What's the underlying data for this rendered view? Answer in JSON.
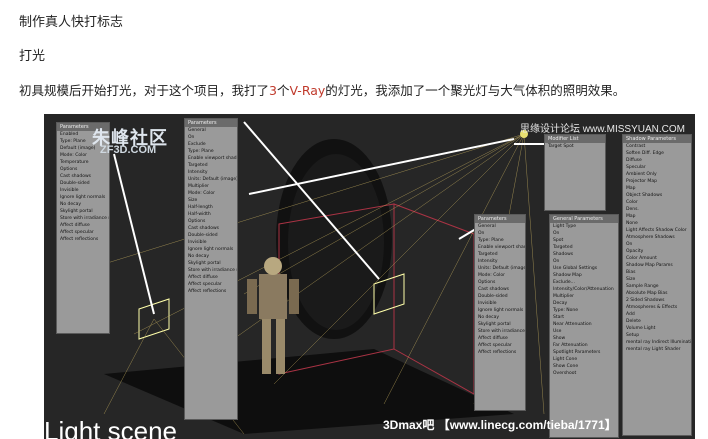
{
  "article": {
    "line1": "制作真人快打标志",
    "line2": "打光",
    "line3_pre": "初具规模后开始打光，对于这个项目，我打了",
    "line3_num": "3",
    "line3_mid": "个",
    "line3_vray": "V-Ray",
    "line3_post": "的灯光，我添加了一个聚光灯与大气体积的照明效果。"
  },
  "screenshot": {
    "watermark_logo": "朱峰社区",
    "watermark_site": "ZF3D.COM",
    "watermark_topright": "思缘设计论坛 www.MISSYUAN.COM",
    "caption": "Light scene",
    "footer": "3Dmax吧 【www.linecg.com/tieba/1771】",
    "panels": {
      "left_title": "Parameters",
      "left_rows": [
        "Enabled",
        "Type: Plane",
        "Default (image)",
        "Mode: Color",
        "Temperature",
        "Options",
        "Cast shadows",
        "Double-sided",
        "Invisible",
        "Ignore light normals",
        "No decay",
        "Skylight portal",
        "Store with irradiance map",
        "Affect diffuse",
        "Affect specular",
        "Affect reflections"
      ],
      "mid_title": "Parameters",
      "mid_rows": [
        "General",
        "On",
        "Exclude",
        "Type: Plane",
        "Enable viewport shading",
        "Targeted",
        "Intensity",
        "Units: Default (image)",
        "Multiplier",
        "Mode: Color",
        "Size",
        "Half-length",
        "Half-width",
        "Options",
        "Cast shadows",
        "Double-sided",
        "Invisible",
        "Ignore light normals",
        "No decay",
        "Skylight portal",
        "Store with irradiance map",
        "Affect diffuse",
        "Affect specular",
        "Affect reflections"
      ],
      "center_title": "Parameters",
      "center_rows": [
        "General",
        "On",
        "Type: Plane",
        "Enable viewport shading",
        "Targeted",
        "Intensity",
        "Units: Default (image)",
        "Mode: Color",
        "Options",
        "Cast shadows",
        "Double-sided",
        "Invisible",
        "Ignore light normals",
        "No decay",
        "Skylight portal",
        "Store with irradiance map",
        "Affect diffuse",
        "Affect specular",
        "Affect reflections"
      ],
      "right1_title": "Modifier List",
      "right1_rows": [
        "Target Spot"
      ],
      "right2_title": "General Parameters",
      "right2_rows": [
        "Light Type",
        "On",
        "Spot",
        "Targeted",
        "Shadows",
        "On",
        "Use Global Settings",
        "Shadow Map",
        "Exclude...",
        "Intensity/Color/Attenuation",
        "Multiplier",
        "Decay",
        "Type: None",
        "Start",
        "Near Attenuation",
        "Use",
        "Show",
        "Far Attenuation",
        "Spotlight Parameters",
        "Light Cone",
        "Show Cone",
        "Overshoot"
      ],
      "right3_title": "Shadow Parameters",
      "right3_rows": [
        "Contrast",
        "Soften Diff. Edge",
        "Diffuse",
        "Specular",
        "Ambient Only",
        "Projector Map",
        "Map",
        "Object Shadows",
        "Color",
        "Dens.",
        "Map",
        "None",
        "Light Affects Shadow Color",
        "Atmosphere Shadows",
        "On",
        "Opacity",
        "Color Amount",
        "Shadow Map Params",
        "Bias",
        "Size",
        "Sample Range",
        "Absolute Map Bias",
        "2 Sided Shadows",
        "Atmospheres & Effects",
        "Add",
        "Delete",
        "Volume Light",
        "Setup",
        "mental ray Indirect Illumination",
        "mental ray Light Shader"
      ]
    }
  }
}
